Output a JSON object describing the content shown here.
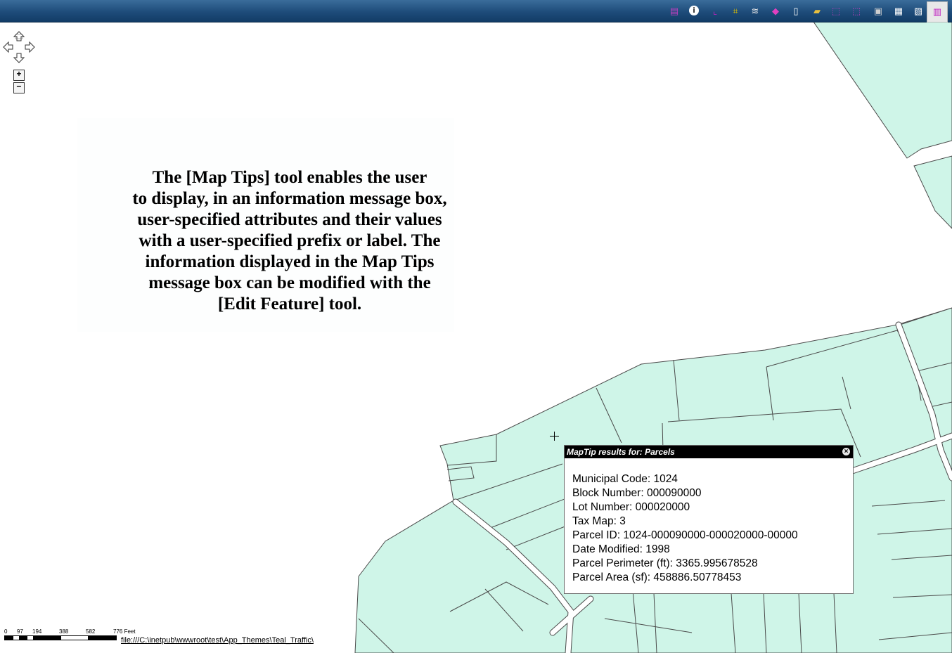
{
  "toolbar": {
    "icons": [
      "layers-icon",
      "identify-icon",
      "select-feature-icon",
      "clip-icon",
      "stack-icon",
      "diamond-icon",
      "page-icon",
      "open-folder-icon",
      "select-rect-icon",
      "select-poly-icon",
      "print-icon",
      "table-icon",
      "chart-icon",
      "map-tips-icon"
    ]
  },
  "zoom": {
    "in_label": "+",
    "out_label": "−"
  },
  "info": {
    "text": "The [Map Tips] tool enables the user\nto display, in an information message box,\nuser-specified attributes and their values\nwith a user-specified prefix or label.  The\ninformation displayed in the Map Tips\nmessage box can be modified with the\n[Edit Feature] tool."
  },
  "maptip": {
    "title": "MapTip results for: Parcels",
    "close_label": "×",
    "lines": [
      "Municipal Code: 1024",
      "Block Number: 000090000",
      "Lot Number: 000020000",
      "Tax Map: 3",
      "Parcel ID: 1024-000090000-000020000-00000",
      "Date Modified: 1998",
      "Parcel Perimeter (ft): 3365.995678528",
      "Parcel Area (sf): 458886.50778453"
    ]
  },
  "scale": {
    "labels": [
      "0",
      "97",
      "194",
      "388",
      "582",
      "776 Feet"
    ]
  },
  "status": {
    "link": "file:///C:\\inetpub\\wwwroot\\test\\App_Themes\\Teal_Traffic\\"
  },
  "colors": {
    "parcel_fill": "#cff5e8",
    "parcel_stroke": "#4a4a4a",
    "toolbar_bg": "#1e4c7a"
  }
}
